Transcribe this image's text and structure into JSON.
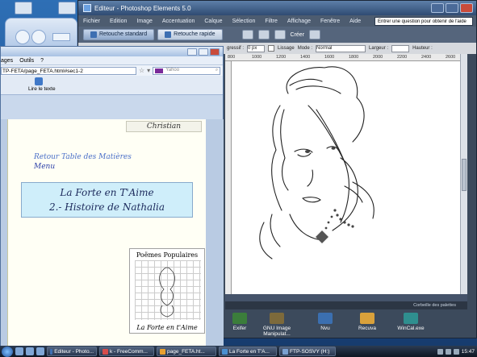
{
  "photoshop": {
    "title": "Editeur - Photoshop Elements 5.0",
    "menu": [
      "Fichier",
      "Edition",
      "Image",
      "Accentuation",
      "Calque",
      "Sélection",
      "Filtre",
      "Affichage",
      "Fenêtre",
      "Aide"
    ],
    "help_placeholder": "Entrer une question pour obtenir de l'aide",
    "tabs": [
      "Retouche standard",
      "Retouche rapide"
    ],
    "create_label": "Créer",
    "options": {
      "feather_label": "gressif :",
      "feather_value": "0 px",
      "antialias_label": "Lissage",
      "mode_label": "Mode :",
      "mode_value": "Normal",
      "width_label": "Largeur :",
      "height_label": "Hauteur :"
    },
    "ruler_ticks": [
      "800",
      "1000",
      "1200",
      "1400",
      "1600",
      "1800",
      "2000",
      "2200",
      "2400",
      "2600"
    ],
    "palette_bin_label": "Corbeille des palettes"
  },
  "desktop_icons": [
    {
      "label": "Exifer",
      "color": "#3b7d3b"
    },
    {
      "label": "GNU Image Manipulat...",
      "color": "#7d6a3b"
    },
    {
      "label": "Nvu",
      "color": "#3b6fb0"
    },
    {
      "label": "Recuva",
      "color": "#d9a13b"
    },
    {
      "label": "WinCal.exe",
      "color": "#2f8f8f"
    }
  ],
  "browser": {
    "menu": [
      "ages",
      "Outils",
      "?"
    ],
    "url": "TP-FETA/page_FETA.html#sec1-2",
    "search_placeholder": "Yahoo",
    "read_button": "Lire le texte",
    "page": {
      "signature": "Christian",
      "link_toc": "Retour Table des Matières",
      "link_menu": "Menu",
      "title_line1": "La Forte en T'Aime",
      "title_line2": "2.- Histoire de Nathalia",
      "thumb_top": "Poëmes Populaires",
      "thumb_bottom": "La Forte en t'Aime"
    }
  },
  "taskbar": {
    "items": [
      {
        "label": "Editeur - Photo...",
        "color": "#3d6fb2"
      },
      {
        "label": "k - FreeComm...",
        "color": "#d64c4c"
      },
      {
        "label": "page_FETA.ht...",
        "color": "#e8a030"
      },
      {
        "label": "La Forte en T'A...",
        "color": "#4a8fd0"
      },
      {
        "label": "FTP-SOSVY (H:)",
        "color": "#7aa0d0"
      }
    ],
    "clock": "15:47"
  }
}
